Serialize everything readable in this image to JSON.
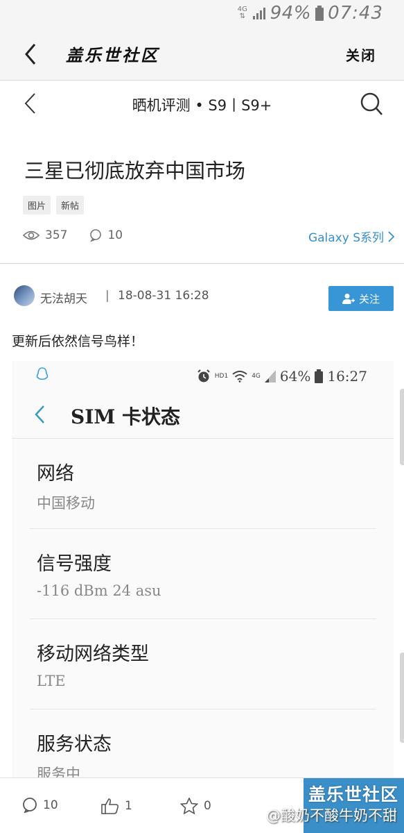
{
  "status_bar": {
    "network": "4G",
    "battery": "94%",
    "time": "07:43"
  },
  "app_header": {
    "title": "盖乐世社区",
    "close_label": "关闭"
  },
  "nav": {
    "title": "晒机评测 • S9丨S9+"
  },
  "post": {
    "title": "三星已彻底放弃中国市场",
    "tags": [
      "图片",
      "新帖"
    ],
    "views": "357",
    "comments": "10",
    "series_link": "Galaxy S系列",
    "author": "无法胡天",
    "separator": "|",
    "date": "18-08-31 16:28",
    "follow_label": "关注",
    "text": "更新后依然信号鸟样！"
  },
  "embedded": {
    "status": {
      "hd": "HD1",
      "net": "4G",
      "battery": "64%",
      "time": "16:27"
    },
    "title": "SIM 卡状态",
    "items": [
      {
        "label": "网络",
        "value": "中国移动"
      },
      {
        "label": "信号强度",
        "value": "-116 dBm 24 asu"
      },
      {
        "label": "移动网络类型",
        "value": "LTE"
      },
      {
        "label": "服务状态",
        "value": "服务中"
      }
    ]
  },
  "bottom_bar": {
    "comments": "10",
    "likes": "1",
    "favorites": "0",
    "watermark_title": "盖乐世社区",
    "watermark_user": "@酸奶不酸牛奶不甜"
  },
  "colors": {
    "accent": "#3896d6",
    "link": "#3a8fc9"
  }
}
